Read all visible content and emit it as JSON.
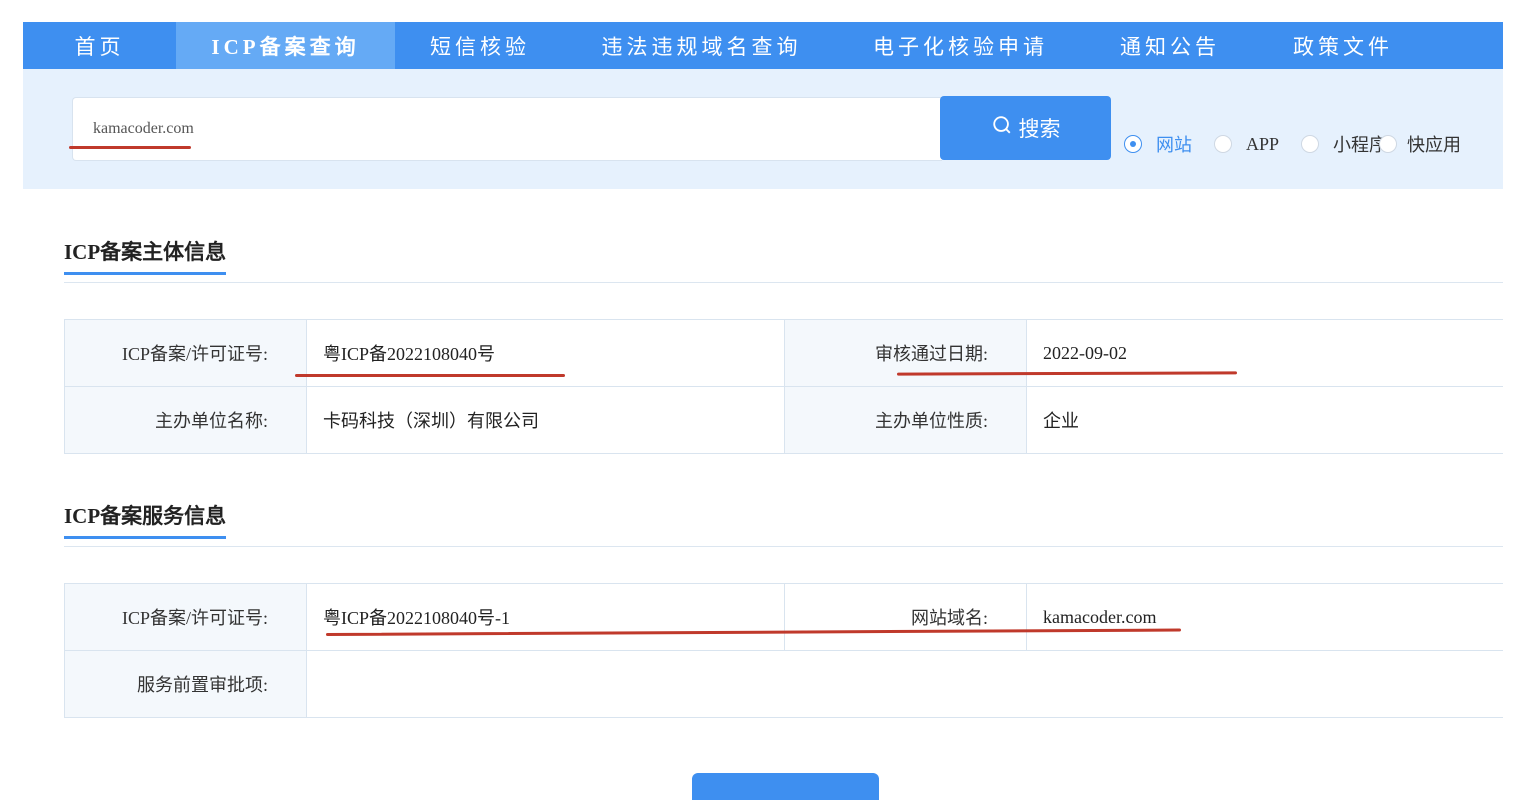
{
  "nav": {
    "items": [
      {
        "label": "首页"
      },
      {
        "label": "ICP备案查询"
      },
      {
        "label": "短信核验"
      },
      {
        "label": "违法违规域名查询"
      },
      {
        "label": "电子化核验申请"
      },
      {
        "label": "通知公告"
      },
      {
        "label": "政策文件"
      }
    ],
    "active_index": 1
  },
  "search": {
    "value": "kamacoder.com",
    "button_label": "搜索",
    "options": [
      {
        "label": "网站",
        "checked": true
      },
      {
        "label": "APP",
        "checked": false
      },
      {
        "label": "小程序",
        "checked": false
      },
      {
        "label": "快应用",
        "checked": false
      }
    ]
  },
  "subject_info": {
    "title": "ICP备案主体信息",
    "rows": [
      {
        "label1": "ICP备案/许可证号:",
        "value1": "粤ICP备2022108040号",
        "label2": "审核通过日期:",
        "value2": "2022-09-02"
      },
      {
        "label1": "主办单位名称:",
        "value1": "卡码科技（深圳）有限公司",
        "label2": "主办单位性质:",
        "value2": "企业"
      }
    ]
  },
  "service_info": {
    "title": "ICP备案服务信息",
    "rows": [
      {
        "label1": "ICP备案/许可证号:",
        "value1": "粤ICP备2022108040号-1",
        "label2": "网站域名:",
        "value2": "kamacoder.com"
      },
      {
        "label1": "服务前置审批项:",
        "value1": ""
      }
    ]
  },
  "colors": {
    "primary": "#3e8ff0",
    "nav_active": "#65aaf5",
    "search_bg": "#e6f1fd",
    "annotation": "#c0392b"
  }
}
